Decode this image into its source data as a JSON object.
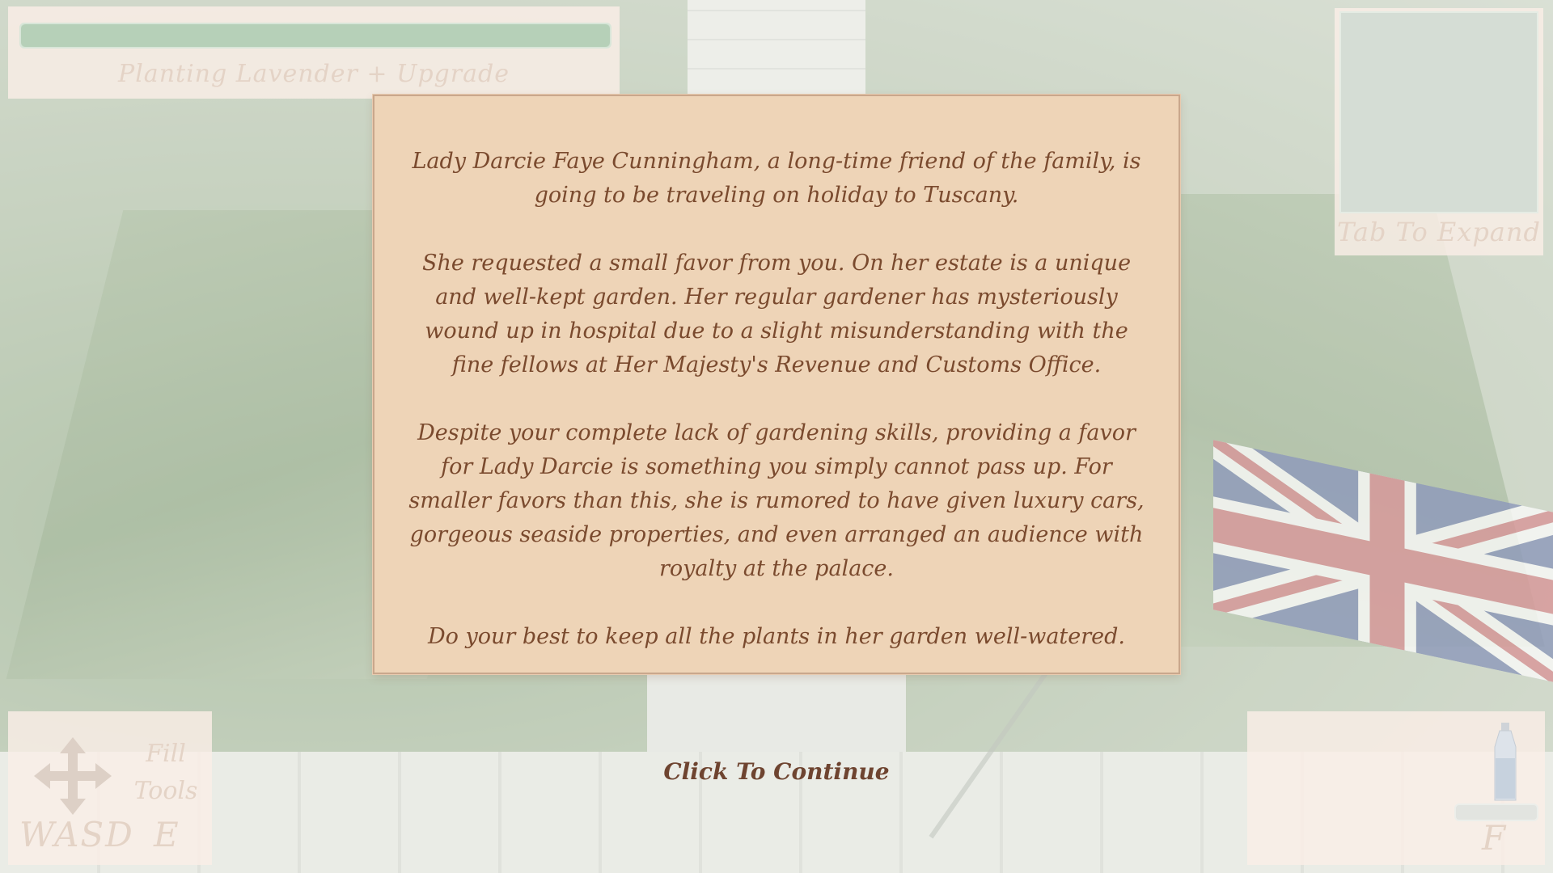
{
  "hud": {
    "task": {
      "label": "Planting Lavender + Upgrade",
      "progress": 1.0,
      "bar_color": "#b6d0b8"
    },
    "map": {
      "label": "Tab To Expand"
    },
    "controls": {
      "move_icon": "move-arrows-icon",
      "fill_line1": "Fill",
      "fill_line2": "Tools",
      "move_key": "WASD",
      "fill_key": "E"
    },
    "tool": {
      "icon": "water-bottle-icon",
      "key": "F",
      "level": 1.0
    }
  },
  "dialog": {
    "paragraphs": [
      "Lady Darcie Faye Cunningham, a long-time friend of the family, is going to be traveling on holiday to Tuscany.",
      "She requested a small favor from you. On her estate is a unique and well-kept garden. Her regular gardener has mysteriously wound up in hospital due to a slight misunderstanding with the fine fellows at Her Majesty's Revenue and Customs Office.",
      "Despite your complete lack of gardening skills, providing a favor for Lady Darcie is something you simply cannot pass up. For smaller favors than this, she is rumored to have given luxury cars, gorgeous seaside properties, and even arranged an audience with royalty at the palace.",
      "Do your best to keep all the plants in her garden well-watered."
    ],
    "continue_label": "Click To Continue"
  },
  "colors": {
    "dialog_bg": "#eed4b7",
    "dialog_text": "#7a4a2e",
    "hud_panel": "#faeee6"
  }
}
